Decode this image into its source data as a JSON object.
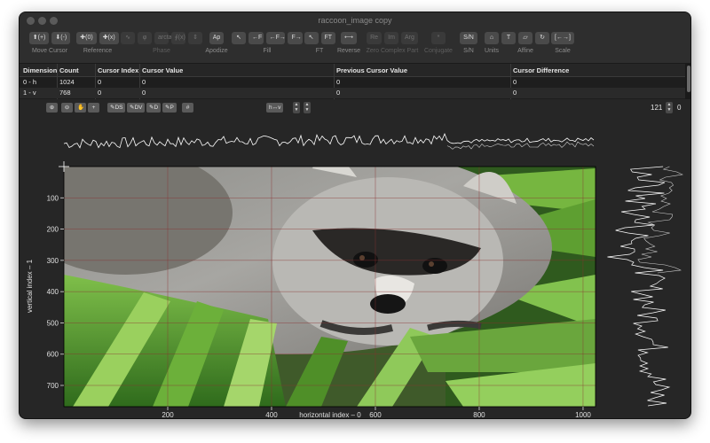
{
  "window": {
    "title": "raccoon_image copy"
  },
  "toolbar": {
    "groups": [
      {
        "id": "move-cursor",
        "label": "Move Cursor",
        "enabled": true,
        "buttons": [
          "⬆(+)",
          "⬇(-)"
        ]
      },
      {
        "id": "reference",
        "label": "Reference",
        "enabled": true,
        "buttons": [
          "✚(0)",
          "✚(x)"
        ]
      },
      {
        "id": "phase",
        "label": "Phase",
        "enabled": false,
        "buttons": [
          "∿",
          "φ",
          "arctan",
          "∮(x)",
          "⇕"
        ]
      },
      {
        "id": "apodize",
        "label": "Apodize",
        "enabled": true,
        "buttons": [
          "Ap"
        ]
      },
      {
        "id": "fill",
        "label": "Fill",
        "enabled": true,
        "buttons": [
          "↖",
          "←F",
          "←F→",
          "F→"
        ]
      },
      {
        "id": "ft",
        "label": "FT",
        "enabled": true,
        "buttons": [
          "↖",
          "FT"
        ]
      },
      {
        "id": "reverse",
        "label": "Reverse",
        "enabled": true,
        "buttons": [
          "⟷"
        ]
      },
      {
        "id": "zero-complex-part",
        "label": "Zero Complex Part",
        "enabled": false,
        "buttons": [
          "Re",
          "Im",
          "Arg"
        ]
      },
      {
        "id": "conjugate",
        "label": "Conjugate",
        "enabled": false,
        "buttons": [
          "*"
        ]
      },
      {
        "id": "sn",
        "label": "S/N",
        "enabled": true,
        "buttons": [
          "S/N"
        ]
      },
      {
        "id": "units",
        "label": "Units",
        "enabled": true,
        "buttons": [
          "⌂"
        ]
      },
      {
        "id": "affine",
        "label": "Affine",
        "enabled": true,
        "buttons": [
          "T",
          "▱",
          "↻"
        ]
      },
      {
        "id": "scale",
        "label": "Scale",
        "enabled": true,
        "buttons": [
          "[←→]"
        ]
      }
    ]
  },
  "table": {
    "columns": [
      "Dimension",
      "Count",
      "Cursor Index",
      "Cursor Value",
      "Previous Cursor Value",
      "Cursor Difference"
    ],
    "rows": [
      [
        "0 - h",
        "1024",
        "0",
        "0",
        "0",
        "0"
      ],
      [
        "1 - v",
        "768",
        "0",
        "0",
        "0",
        "0"
      ]
    ]
  },
  "controls": {
    "zoom_buttons": [
      "⊕",
      "⊖",
      "✋",
      "+"
    ],
    "display_buttons": [
      "✎DS",
      "✎DV",
      "✎D",
      "✎P"
    ],
    "grid_button": "#",
    "hv_button": "h↔v",
    "level_value": "121",
    "level_readout": "0"
  },
  "plot": {
    "xlabel": "horizontal index – 0",
    "ylabel": "vertical index – 1",
    "x_ticks": [
      "200",
      "400",
      "600",
      "800",
      "1000"
    ],
    "y_ticks": [
      "100",
      "200",
      "300",
      "400",
      "500",
      "600",
      "700"
    ],
    "x_range": [
      0,
      1024
    ],
    "y_range": [
      0,
      768
    ],
    "cursor": {
      "x": 0,
      "y": 0
    },
    "image_description_icon": "raccoon-photo",
    "colors": {
      "projection": "#ffffff",
      "grid": "#8a3030",
      "axes": "#e0e0e0"
    }
  }
}
